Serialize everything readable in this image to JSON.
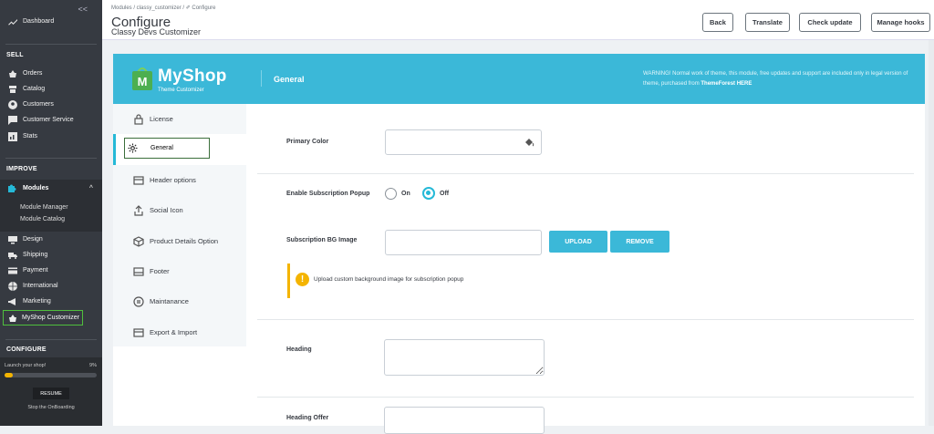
{
  "sidebar": {
    "collapse_label": "<<",
    "dashboard": "Dashboard",
    "sell_title": "SELL",
    "sell_items": [
      "Orders",
      "Catalog",
      "Customers",
      "Customer Service",
      "Stats"
    ],
    "improve_title": "IMPROVE",
    "modules": "Modules",
    "modules_sub": [
      "Module Manager",
      "Module Catalog"
    ],
    "improve_items": [
      "Design",
      "Shipping",
      "Payment",
      "International",
      "Marketing"
    ],
    "myshop": "MyShop Customizer",
    "configure_title": "CONFIGURE",
    "launch_text": "Launch your shop!",
    "launch_percent": "9%",
    "launch_progress": 0.09,
    "resume": "RESUME",
    "stop": "Stop the OnBoarding"
  },
  "header": {
    "breadcrumb": "Modules  /  classy_customizer  /  ✐ Configure",
    "title": "Configure",
    "subtitle": "Classy Devs Customizer",
    "buttons": [
      "Back",
      "Translate",
      "Check update",
      "Manage hooks"
    ]
  },
  "banner": {
    "brand": "MyShop",
    "brand_sub": "Theme Customizer",
    "logo_letter": "M",
    "section": "General",
    "warning_prefix": "WARNING! Normal work of theme, this module, free updates and support are included only in legal version of theme, purchased from",
    "warning_link": "ThemeForest HERE",
    "color": "#3bb8d8"
  },
  "tabs": [
    "License",
    "General",
    "Header options",
    "Social Icon",
    "Product Details Option",
    "Footer",
    "Maintanance",
    "Export & Import"
  ],
  "form": {
    "primary_color_label": "Primary Color",
    "primary_color_value": "",
    "subscription_popup_label": "Enable Subscription Popup",
    "on_label": "On",
    "off_label": "Off",
    "popup_selected": "Off",
    "bg_image_label": "Subscription BG Image",
    "bg_image_value": "",
    "upload": "UPLOAD",
    "remove": "REMOVE",
    "alert": "Upload custom background image for subscription popup",
    "heading_label": "Heading",
    "heading_value": "",
    "heading_offer_label": "Heading Offer",
    "heading_offer_value": ""
  }
}
